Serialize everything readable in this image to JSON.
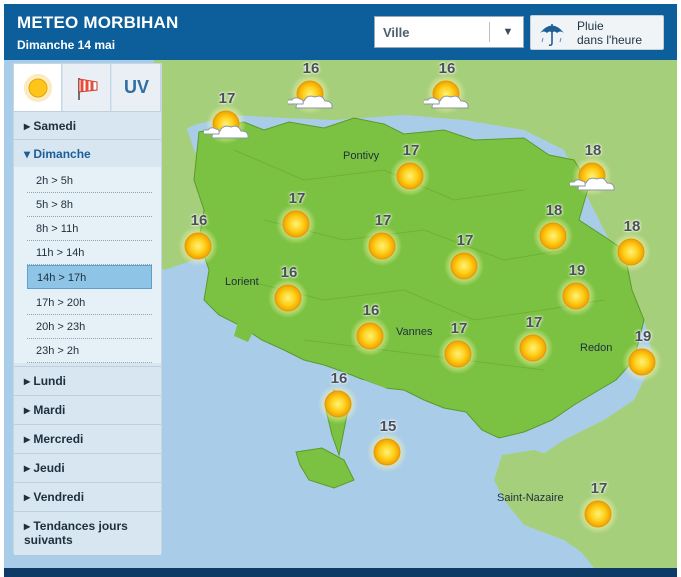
{
  "header": {
    "title": "METEO MORBIHAN",
    "date": "Dimanche 14 mai"
  },
  "ville_select": {
    "label": "Ville",
    "icon": "chevron-down-icon"
  },
  "rain_button": {
    "line1": "Pluie",
    "line2": "dans l'heure",
    "icon": "umbrella-icon"
  },
  "tabs": [
    {
      "name": "sun",
      "icon": "sun-icon",
      "active": true
    },
    {
      "name": "wind",
      "icon": "windsock-icon",
      "active": false
    },
    {
      "name": "uv",
      "label": "UV",
      "active": false
    }
  ],
  "days": {
    "samedi": "Samedi",
    "dimanche": "Dimanche",
    "lundi": "Lundi",
    "mardi": "Mardi",
    "mercredi": "Mercredi",
    "jeudi": "Jeudi",
    "vendredi": "Vendredi",
    "tendances": "Tendances jours suivants"
  },
  "slots": [
    "2h > 5h",
    "5h > 8h",
    "8h > 11h",
    "11h > 14h",
    "14h > 17h",
    "17h > 20h",
    "20h > 23h",
    "23h > 2h"
  ],
  "active_slot": "14h > 17h",
  "map": {
    "places": {
      "pontivy": "Pontivy",
      "lorient": "Lorient",
      "vannes": "Vannes",
      "redon": "Redon",
      "saint_nazaire": "Saint-Nazaire"
    },
    "markers": [
      {
        "temp": "17",
        "icon": "partly-cloudy-icon"
      },
      {
        "temp": "16",
        "icon": "partly-cloudy-icon"
      },
      {
        "temp": "16",
        "icon": "partly-cloudy-icon"
      },
      {
        "temp": "18",
        "icon": "partly-cloudy-icon"
      },
      {
        "temp": "17",
        "icon": "sun-icon"
      },
      {
        "temp": "16",
        "icon": "sun-icon"
      },
      {
        "temp": "17",
        "icon": "sun-icon"
      },
      {
        "temp": "17",
        "icon": "sun-icon"
      },
      {
        "temp": "17",
        "icon": "sun-icon"
      },
      {
        "temp": "18",
        "icon": "sun-icon"
      },
      {
        "temp": "18",
        "icon": "sun-icon"
      },
      {
        "temp": "16",
        "icon": "sun-icon"
      },
      {
        "temp": "19",
        "icon": "sun-icon"
      },
      {
        "temp": "16",
        "icon": "sun-icon"
      },
      {
        "temp": "17",
        "icon": "sun-icon"
      },
      {
        "temp": "17",
        "icon": "sun-icon"
      },
      {
        "temp": "19",
        "icon": "sun-icon"
      },
      {
        "temp": "16",
        "icon": "sun-icon"
      },
      {
        "temp": "15",
        "icon": "sun-icon"
      },
      {
        "temp": "17",
        "icon": "sun-icon"
      }
    ]
  },
  "colors": {
    "header": "#0d5f9c",
    "sea": "#a9cde9",
    "land": "#7cc242",
    "sidebar": "#d7e6f0",
    "active_slot": "#8ec4e6"
  }
}
